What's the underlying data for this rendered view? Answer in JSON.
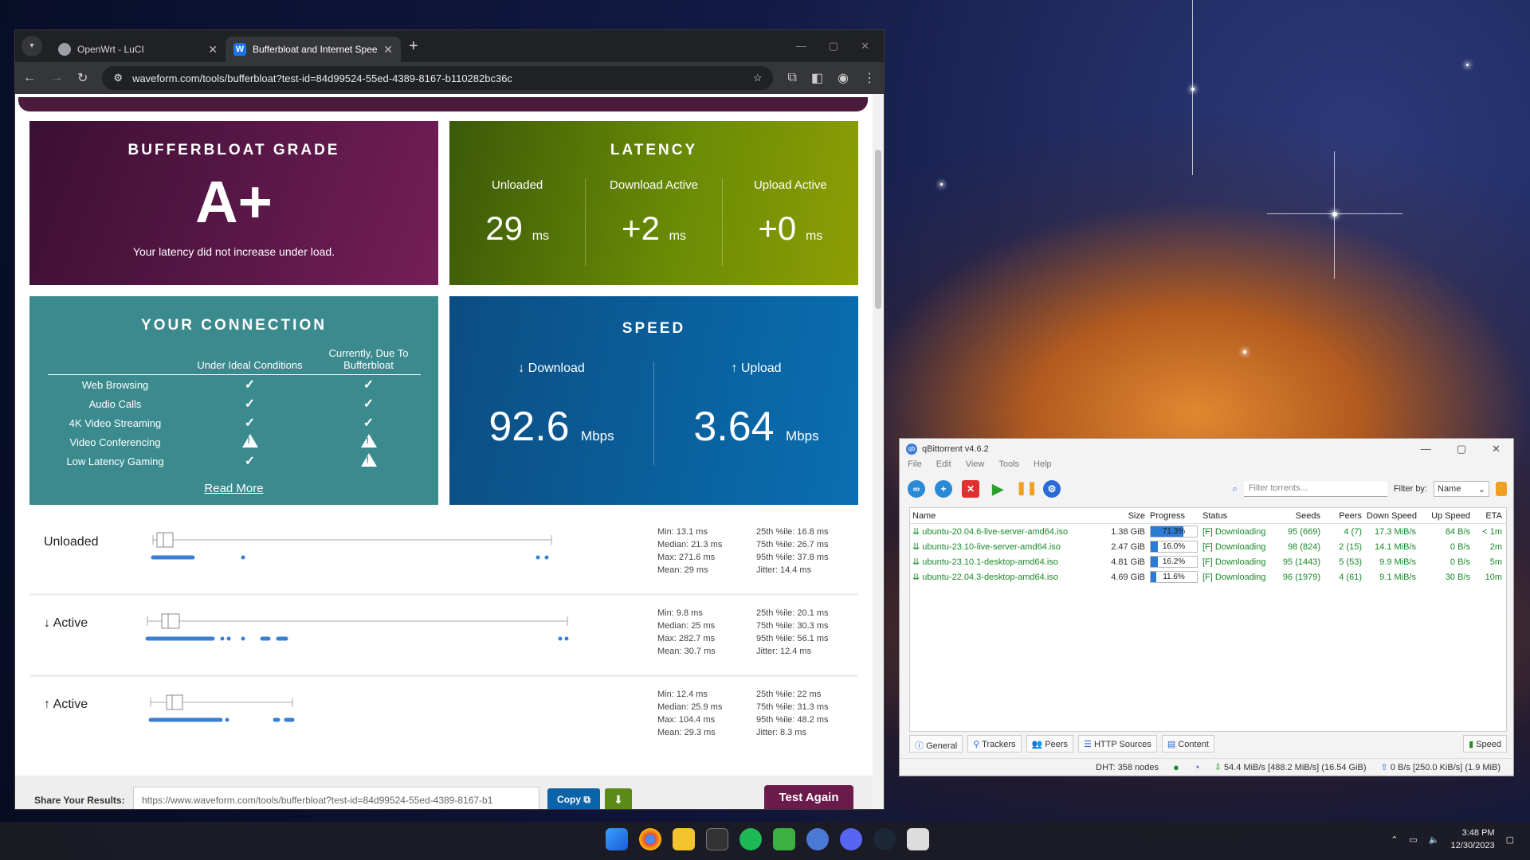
{
  "browser": {
    "tabs": [
      {
        "title": "OpenWrt - LuCI",
        "active": false
      },
      {
        "title": "Bufferbloat and Internet Speed",
        "active": true
      }
    ],
    "url": "waveform.com/tools/bufferbloat?test-id=84d99524-55ed-4389-8167-b110282bc36c"
  },
  "grade": {
    "title": "BUFFERBLOAT GRADE",
    "value": "A+",
    "subtitle": "Your latency did not increase under load."
  },
  "latency": {
    "title": "LATENCY",
    "cols": [
      {
        "label": "Unloaded",
        "value": "29",
        "unit": "ms"
      },
      {
        "label": "Download Active",
        "value": "+2",
        "unit": "ms"
      },
      {
        "label": "Upload Active",
        "value": "+0",
        "unit": "ms"
      }
    ]
  },
  "connection": {
    "title": "YOUR CONNECTION",
    "col1": "Under Ideal Conditions",
    "col2": "Currently, Due To Bufferbloat",
    "rows": [
      {
        "label": "Web Browsing",
        "ideal": "check",
        "current": "check"
      },
      {
        "label": "Audio Calls",
        "ideal": "check",
        "current": "check"
      },
      {
        "label": "4K Video Streaming",
        "ideal": "check",
        "current": "check"
      },
      {
        "label": "Video Conferencing",
        "ideal": "warn",
        "current": "warn"
      },
      {
        "label": "Low Latency Gaming",
        "ideal": "check",
        "current": "warn"
      }
    ],
    "read_more": "Read More"
  },
  "speed": {
    "title": "SPEED",
    "download": {
      "label": "↓ Download",
      "value": "92.6",
      "unit": "Mbps"
    },
    "upload": {
      "label": "↑ Upload",
      "value": "3.64",
      "unit": "Mbps"
    }
  },
  "latency_plots": [
    {
      "name": "Unloaded",
      "min": "Min: 13.1 ms",
      "median": "Median: 21.3 ms",
      "max": "Max: 271.6 ms",
      "mean": "Mean: 29 ms",
      "p25": "25th %ile: 16.8 ms",
      "p75": "75th %ile: 26.7 ms",
      "p95": "95th %ile: 37.8 ms",
      "jitter": "Jitter: 14.4 ms"
    },
    {
      "name": "↓ Active",
      "min": "Min: 9.8 ms",
      "median": "Median: 25 ms",
      "max": "Max: 282.7 ms",
      "mean": "Mean: 30.7 ms",
      "p25": "25th %ile: 20.1 ms",
      "p75": "75th %ile: 30.3 ms",
      "p95": "95th %ile: 56.1 ms",
      "jitter": "Jitter: 12.4 ms"
    },
    {
      "name": "↑ Active",
      "min": "Min: 12.4 ms",
      "median": "Median: 25.9 ms",
      "max": "Max: 104.4 ms",
      "mean": "Mean: 29.3 ms",
      "p25": "25th %ile: 22 ms",
      "p75": "75th %ile: 31.3 ms",
      "p95": "95th %ile: 48.2 ms",
      "jitter": "Jitter: 8.3 ms"
    }
  ],
  "share": {
    "label": "Share Your Results:",
    "url": "https://www.waveform.com/tools/bufferbloat?test-id=84d99524-55ed-4389-8167-b1",
    "copy": "Copy",
    "test_again": "Test Again"
  },
  "qbt": {
    "title": "qBittorrent v4.6.2",
    "menu": [
      "File",
      "Edit",
      "View",
      "Tools",
      "Help"
    ],
    "filter_placeholder": "Filter torrents...",
    "filter_by_label": "Filter by:",
    "filter_by_value": "Name",
    "columns": [
      "Name",
      "Size",
      "Progress",
      "Status",
      "Seeds",
      "Peers",
      "Down Speed",
      "Up Speed",
      "ETA"
    ],
    "torrents": [
      {
        "name": "ubuntu-20.04.6-live-server-amd64.iso",
        "size": "1.38 GiB",
        "progress": 71.3,
        "progress_text": "71.3%",
        "status": "[F] Downloading",
        "seeds": "95 (669)",
        "peers": "4 (7)",
        "down": "17.3 MiB/s",
        "up": "84 B/s",
        "eta": "< 1m"
      },
      {
        "name": "ubuntu-23.10-live-server-amd64.iso",
        "size": "2.47 GiB",
        "progress": 16.0,
        "progress_text": "16.0%",
        "status": "[F] Downloading",
        "seeds": "98 (824)",
        "peers": "2 (15)",
        "down": "14.1 MiB/s",
        "up": "0 B/s",
        "eta": "2m"
      },
      {
        "name": "ubuntu-23.10.1-desktop-amd64.iso",
        "size": "4.81 GiB",
        "progress": 16.2,
        "progress_text": "16.2%",
        "status": "[F] Downloading",
        "seeds": "95 (1443)",
        "peers": "5 (53)",
        "down": "9.9 MiB/s",
        "up": "0 B/s",
        "eta": "5m"
      },
      {
        "name": "ubuntu-22.04.3-desktop-amd64.iso",
        "size": "4.69 GiB",
        "progress": 11.6,
        "progress_text": "11.6%",
        "status": "[F] Downloading",
        "seeds": "96 (1979)",
        "peers": "4 (61)",
        "down": "9.1 MiB/s",
        "up": "30 B/s",
        "eta": "10m"
      }
    ],
    "bottom_tabs": [
      "General",
      "Trackers",
      "Peers",
      "HTTP Sources",
      "Content"
    ],
    "speed_tab": "Speed",
    "dht": "DHT: 358 nodes",
    "down_status": "54.4 MiB/s [488.2 MiB/s] (16.54 GiB)",
    "up_status": "0 B/s [250.0 KiB/s] (1.9 MiB)"
  },
  "taskbar": {
    "time": "3:48 PM",
    "date": "12/30/2023"
  }
}
